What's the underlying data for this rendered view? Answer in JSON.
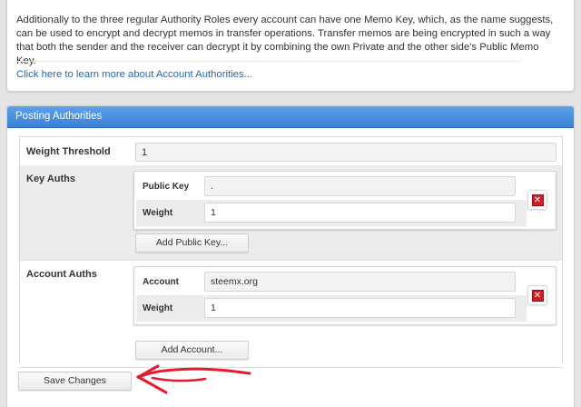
{
  "info": {
    "text": "Additionally to the three regular Authority Roles every account can have one Memo Key, which, as the name suggests, can be used to encrypt and decrypt memos in transfer operations. Transfer memos are being encrypted in such a way that both the sender and the receiver can decrypt it by combining the own Private and the other side's Public Memo Key.",
    "link": "Click here to learn more about Account Authorities..."
  },
  "posting": {
    "title": "Posting Authorities",
    "weight_threshold": {
      "label": "Weight Threshold",
      "value": "1"
    },
    "key_auths": {
      "label": "Key Auths",
      "entries": [
        {
          "public_key_label": "Public Key",
          "public_key_value": ".",
          "weight_label": "Weight",
          "weight_value": "1"
        }
      ],
      "add_button": "Add Public Key..."
    },
    "account_auths": {
      "label": "Account Auths",
      "entries": [
        {
          "account_label": "Account",
          "account_value": "steemx.org",
          "weight_label": "Weight",
          "weight_value": "1"
        }
      ],
      "add_button": "Add Account..."
    },
    "save_button": "Save Changes"
  },
  "icons": {
    "delete": "delete-x-icon",
    "annotation": "red-arrow-annotation-icon"
  },
  "colors": {
    "header_blue": "#3b80d6",
    "link_blue": "#2566b0",
    "delete_red": "#cf1d25",
    "annotation_red": "#e8192c"
  }
}
